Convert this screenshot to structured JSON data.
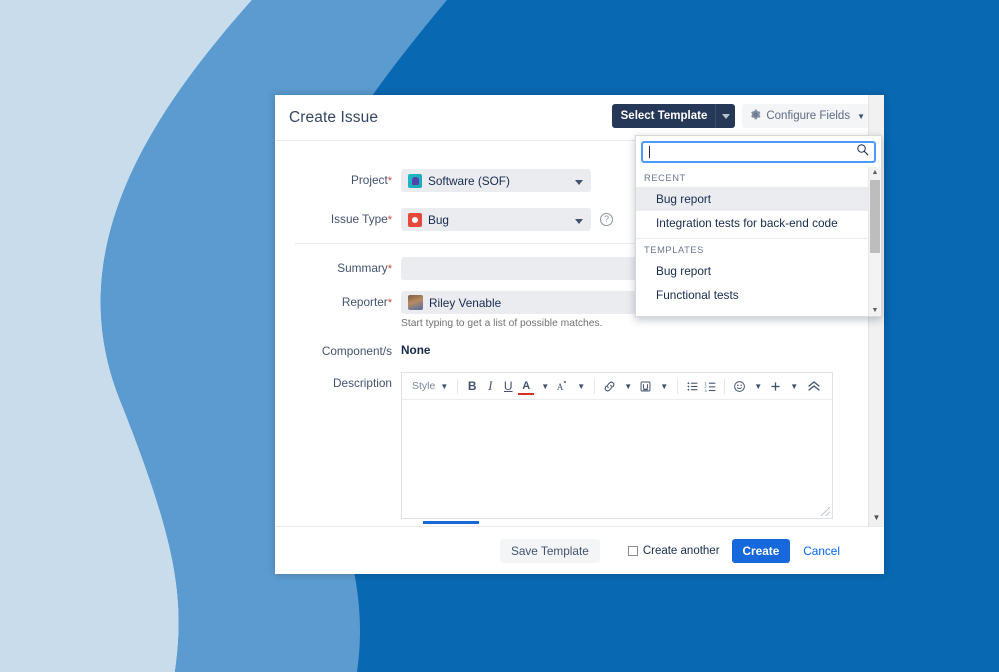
{
  "background": {
    "colors": {
      "light": "#c8dcec",
      "mid": "#5b9bd0",
      "dark": "#0868b1"
    }
  },
  "dialog": {
    "title": "Create Issue",
    "header": {
      "select_template_label": "Select Template",
      "configure_fields_label": "Configure Fields",
      "gear_icon": "gear-icon",
      "caret_icon": "chevron-down-icon"
    },
    "fields": {
      "project": {
        "label": "Project",
        "required": "*",
        "value": "Software (SOF)",
        "icon": "project-avatar-icon"
      },
      "issue_type": {
        "label": "Issue Type",
        "required": "*",
        "value": "Bug",
        "icon": "bug-icon",
        "help_icon": "question-mark-icon"
      },
      "summary": {
        "label": "Summary",
        "required": "*",
        "value": ""
      },
      "reporter": {
        "label": "Reporter",
        "required": "*",
        "value": "Riley Venable",
        "hint": "Start typing to get a list of possible matches.",
        "avatar": "user-avatar"
      },
      "components": {
        "label": "Component/s",
        "value": "None"
      },
      "description": {
        "label": "Description",
        "value": ""
      }
    },
    "editor_toolbar": {
      "style_label": "Style",
      "bold": "B",
      "italic": "I",
      "underline": "U",
      "text_color": "A",
      "clear_format": "A",
      "link_icon": "link-icon",
      "mention_icon": "mention-icon",
      "bullet_list_icon": "bullet-list-icon",
      "numbered_list_icon": "numbered-list-icon",
      "emoji_icon": "emoji-icon",
      "plus_icon": "plus-icon",
      "collapse_icon": "chevron-up-icon"
    },
    "footer": {
      "save_template_label": "Save Template",
      "create_another_label": "Create another",
      "create_label": "Create",
      "cancel_label": "Cancel"
    }
  },
  "template_dropdown": {
    "search": {
      "value": "",
      "placeholder": "",
      "icon": "search-icon"
    },
    "sections": [
      {
        "title": "RECENT",
        "items": [
          {
            "label": "Bug report",
            "active": true
          },
          {
            "label": "Integration tests for back-end code",
            "active": false
          }
        ]
      },
      {
        "title": "TEMPLATES",
        "items": [
          {
            "label": "Bug report",
            "active": false
          },
          {
            "label": "Functional tests",
            "active": false
          }
        ]
      }
    ],
    "scrollbar": {
      "up_icon": "scroll-up-arrow",
      "down_icon": "scroll-down-arrow"
    }
  }
}
